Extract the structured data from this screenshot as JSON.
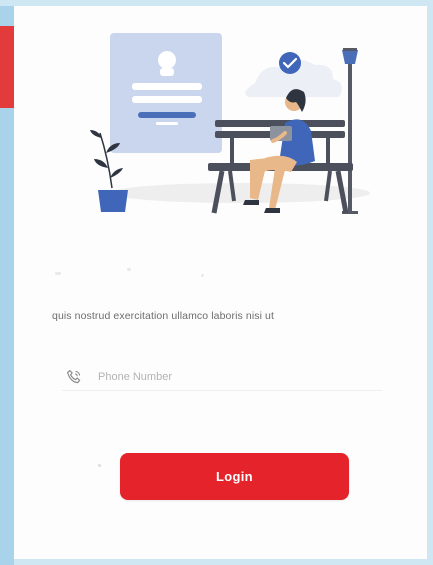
{
  "subtitle": "quis nostrud exercitation ullamco laboris nisi ut",
  "phone_field": {
    "placeholder": "Phone Number",
    "value": "",
    "icon": "phone-icon"
  },
  "login_button": {
    "label": "Login"
  },
  "illustration": {
    "icon": "person-on-bench-illustration",
    "badge_icon": "check-badge-icon"
  },
  "colors": {
    "accent": "#e4232a",
    "side_bar": "#a9d3ea",
    "side_bar_marker": "#e33b3b",
    "card_blue": "#c9d6ee"
  }
}
